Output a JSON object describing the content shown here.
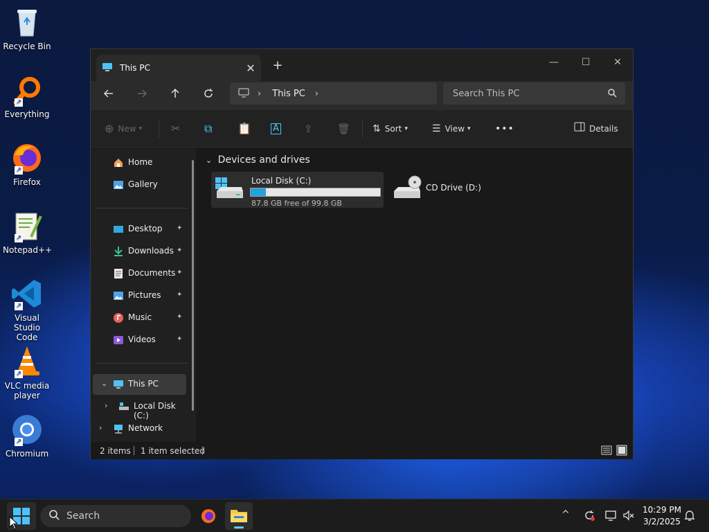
{
  "desktop": {
    "icons": [
      {
        "label": "Recycle Bin"
      },
      {
        "label": "Everything"
      },
      {
        "label": "Firefox"
      },
      {
        "label": "Notepad++"
      },
      {
        "label": "Visual Studio Code"
      },
      {
        "label": "VLC media player"
      },
      {
        "label": "Chromium"
      }
    ]
  },
  "window": {
    "tab_title": "This PC",
    "tab_close": "✕",
    "new_tab": "+",
    "controls": {
      "minimize": "—",
      "maximize": "☐",
      "close": "✕"
    },
    "address": {
      "crumb": "This PC",
      "sep": "›"
    },
    "search_placeholder": "Search This PC",
    "toolbar": {
      "new_label": "New",
      "sort_label": "Sort",
      "view_label": "View",
      "more_label": "•••",
      "details_label": "Details"
    },
    "sidebar": {
      "home": "Home",
      "gallery": "Gallery",
      "desktop": "Desktop",
      "downloads": "Downloads",
      "documents": "Documents",
      "pictures": "Pictures",
      "music": "Music",
      "videos": "Videos",
      "this_pc": "This PC",
      "local_disk": "Local Disk (C:)",
      "network": "Network",
      "pin": "📌"
    },
    "content": {
      "section": "Devices and drives",
      "drives": [
        {
          "name": "Local Disk (C:)",
          "free_text": "87.8 GB free of 99.8 GB",
          "used_fraction": 0.12
        },
        {
          "name": "CD Drive (D:)"
        }
      ]
    },
    "status": {
      "items": "2 items",
      "selected": "1 item selected"
    }
  },
  "taskbar": {
    "search_label": "Search",
    "time": "10:29 PM",
    "date": "3/2/2025",
    "tray_up": "^"
  },
  "colors": {
    "accent": "#26a0da",
    "tray_accent": "#60cdff"
  }
}
